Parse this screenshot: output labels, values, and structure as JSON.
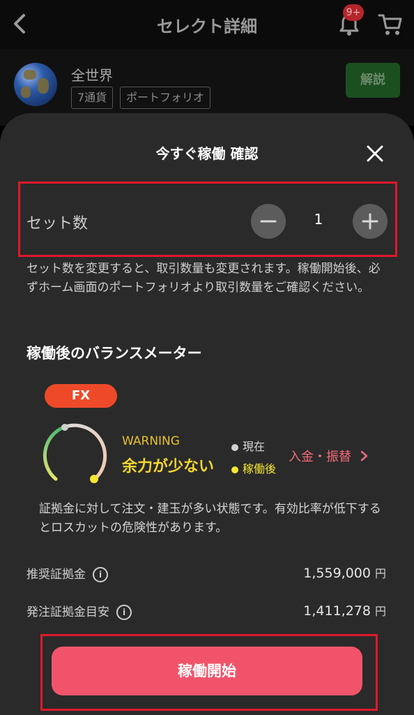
{
  "topbar": {
    "title": "セレクト詳細",
    "badge": "9+",
    "icons": [
      "back-arrow-icon",
      "bell-icon",
      "cart-icon"
    ]
  },
  "product": {
    "name": "全世界",
    "tags": [
      "7通貨",
      "ポートフォリオ"
    ],
    "explain_button": "解説"
  },
  "sheet": {
    "title": "今すぐ稼働 確認",
    "set_count": {
      "label": "セット数",
      "value": "1"
    },
    "note": "セット数を変更すると、取引数量も変更されます。稼働開始後、必ずホーム画面のポートフォリオより取引数量をご確認ください。",
    "balance_title": "稼働後のバランスメーター",
    "meter": {
      "category": "FX",
      "warning_label": "WARNING",
      "warning_text": "余力が少ない",
      "legend_current": "現在",
      "legend_after": "稼働後",
      "deposit_link": "入金・振替",
      "accent_colors": {
        "fx_pill": "#ee4a2a",
        "warning": "#f5d630",
        "link": "#f26a7a",
        "current_dot": "#d0d0d0",
        "after_dot": "#f5e631"
      }
    },
    "description": "証拠金に対して注文・建玉が多い状態です。有効比率が低下するとロスカットの危険性があります。",
    "rows": [
      {
        "label": "推奨証拠金",
        "value": "1,559,000",
        "unit": "円"
      },
      {
        "label": "発注証拠金目安",
        "value": "1,411,278",
        "unit": "円"
      }
    ],
    "cta": "稼働開始"
  }
}
